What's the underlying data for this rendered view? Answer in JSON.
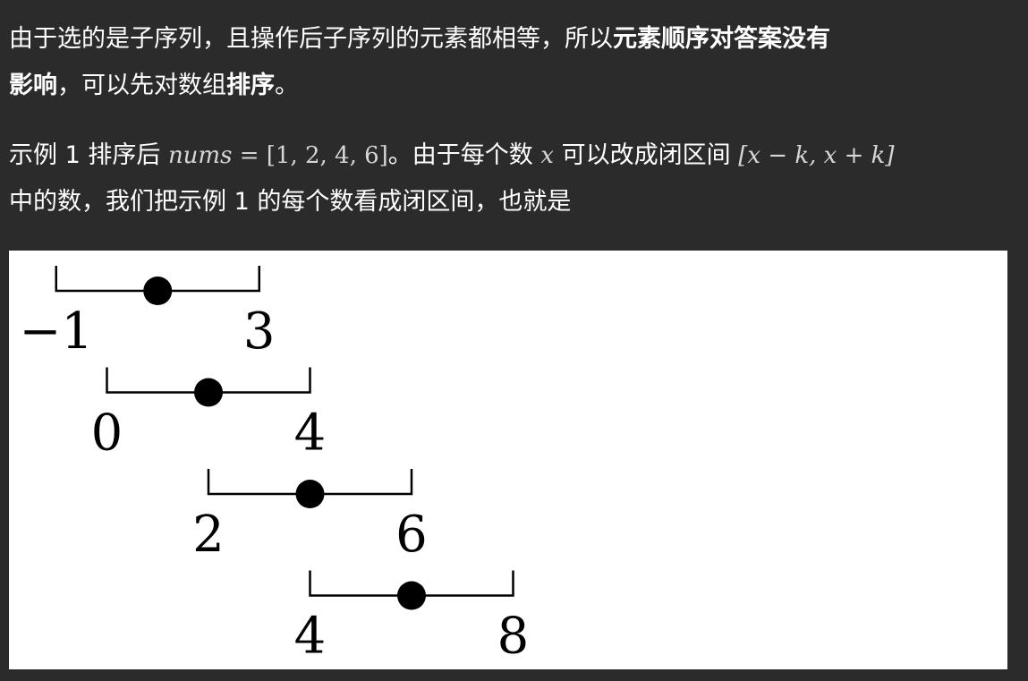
{
  "paragraph1": {
    "line1_plain": "由于选的是子序列，且操作后子序列的元素都相等，所以",
    "line1_bold": "元素顺序对答案没有",
    "line2_bold_a": "影响",
    "line2_plain": "，可以先对数组",
    "line2_bold_b": "排序",
    "line2_end": "。"
  },
  "paragraph2": {
    "line1_a": "示例 1 排序后",
    "math_nums_var": "nums",
    "math_nums_rest": " = [1, 2, 4, 6]",
    "line1_b": "。由于每个数",
    "math_x": "x",
    "line1_c": "可以改成闭区间",
    "math_interval": "[x − k, x + k]",
    "line2": "中的数，我们把示例 1 的每个数看成闭区间，也就是"
  },
  "diagram": {
    "intervals": [
      {
        "center": 1,
        "left_label": "−1",
        "right_label": "3"
      },
      {
        "center": 2,
        "left_label": "0",
        "right_label": "4"
      },
      {
        "center": 4,
        "left_label": "2",
        "right_label": "6"
      },
      {
        "center": 6,
        "left_label": "4",
        "right_label": "8"
      }
    ]
  }
}
